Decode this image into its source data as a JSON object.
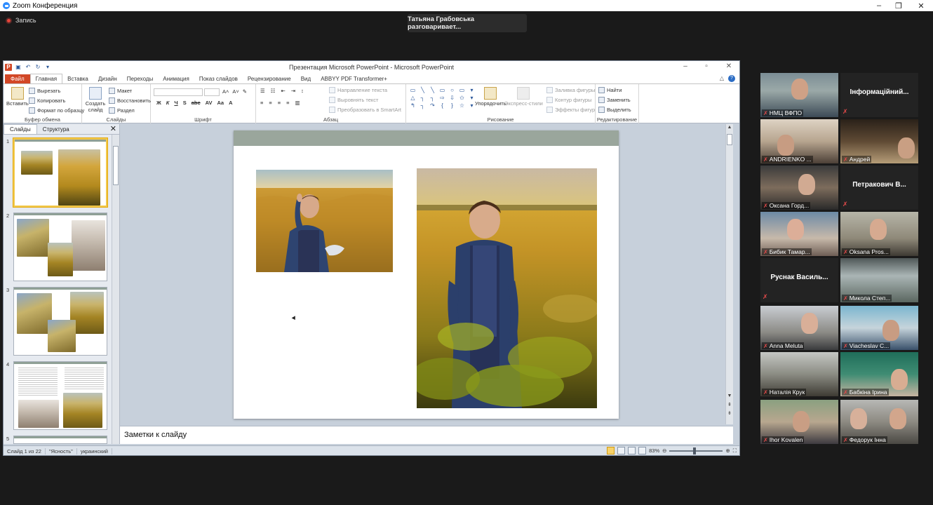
{
  "zoom": {
    "window_title": "Zoom Конференция",
    "record_label": "Запись",
    "speaking_banner": "Татьяна Грабовська разговаривает...",
    "controls": [
      "–",
      "❐",
      "✕"
    ]
  },
  "ppt": {
    "window_title": "Презентация Microsoft PowerPoint  -  Microsoft PowerPoint",
    "tabs": [
      "Файл",
      "Главная",
      "Вставка",
      "Дизайн",
      "Переходы",
      "Анимация",
      "Показ слайдов",
      "Рецензирование",
      "Вид",
      "ABBYY PDF Transformer+"
    ],
    "active_tab": "Главная",
    "ribbon": {
      "clipboard": {
        "name": "Буфер обмена",
        "paste": "Вставить",
        "cut": "Вырезать",
        "copy": "Копировать",
        "format_painter": "Формат по образцу"
      },
      "slides": {
        "name": "Слайды",
        "new_slide": "Создать слайд",
        "layout": "Макет",
        "reset": "Восстановить",
        "section": "Раздел"
      },
      "font": {
        "name": "Шрифт"
      },
      "paragraph": {
        "name": "Абзац",
        "text_direction": "Направление текста",
        "align_text": "Выровнять текст",
        "convert_smartart": "Преобразовать в SmartArt"
      },
      "drawing": {
        "name": "Рисование",
        "arrange": "Упорядочить",
        "quick_styles": "Экспресс-стили",
        "shape_fill": "Заливка фигуры",
        "shape_outline": "Контур фигуры",
        "shape_effects": "Эффекты фигур"
      },
      "editing": {
        "name": "Редактирование",
        "find": "Найти",
        "replace": "Заменить",
        "select": "Выделить"
      }
    },
    "panel": {
      "tabs": [
        "Слайды",
        "Структура"
      ],
      "slide_numbers": [
        "1",
        "2",
        "3",
        "4",
        "5"
      ]
    },
    "notes_placeholder": "Заметки к слайду",
    "status": {
      "slide_counter": "Слайд 1 из 22",
      "theme": "\"Ясность\"",
      "language": "украинский",
      "zoom": "83%"
    }
  },
  "participants": [
    {
      "name": "НМЦ ВФПО",
      "video": true
    },
    {
      "name": "Інформаційний...",
      "video": false
    },
    {
      "name": "ANDRIENKO ...",
      "video": true
    },
    {
      "name": "Андрей",
      "video": true
    },
    {
      "name": "Оксана Горд...",
      "video": true
    },
    {
      "name": "Петракович  В...",
      "video": false
    },
    {
      "name": "Бибик Тамар...",
      "video": true
    },
    {
      "name": "Oksana Pros...",
      "video": true
    },
    {
      "name": "Руснак  Василь...",
      "video": false
    },
    {
      "name": "Микола Степ...",
      "video": true
    },
    {
      "name": "Anna Meluta",
      "video": true
    },
    {
      "name": "Viacheslav C...",
      "video": true
    },
    {
      "name": "Наталія Крук",
      "video": true
    },
    {
      "name": "Бабкіна Ірина",
      "video": true
    },
    {
      "name": "Ihor Kovalen",
      "video": true
    },
    {
      "name": "Федорук Інна",
      "video": true
    }
  ]
}
